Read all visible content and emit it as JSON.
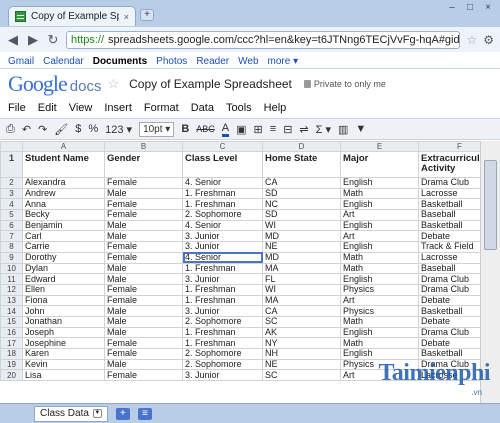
{
  "browser": {
    "tab_title": "Copy of Example Spreadsheet",
    "tab_close": "×",
    "new_tab": "+",
    "window_controls": [
      "–",
      "□",
      "×"
    ],
    "address_scheme": "https://",
    "address_rest": "spreadsheets.google.com/ccc?hl=en&key=t6JTNng6TECjVvFg-hqA#gid=0"
  },
  "google_bar": {
    "links": [
      "Gmail",
      "Calendar",
      "Documents",
      "Photos",
      "Reader",
      "Web",
      "more ▾"
    ],
    "active": "Documents"
  },
  "doc": {
    "logo_google": "Google",
    "logo_docs": "docs",
    "title": "Copy of Example Spreadsheet",
    "privacy": "Private to only me"
  },
  "menu": [
    "File",
    "Edit",
    "View",
    "Insert",
    "Format",
    "Data",
    "Tools",
    "Help"
  ],
  "toolbar": {
    "currency": "$",
    "percent": "%",
    "number_format": "123 ▾",
    "font_size": "10pt ▾",
    "bold": "B",
    "strike": "ABC",
    "sum": "Σ ▾"
  },
  "grid": {
    "column_letters": [
      "A",
      "B",
      "C",
      "D",
      "E",
      "F"
    ],
    "headers": [
      "Student Name",
      "Gender",
      "Class Level",
      "Home State",
      "Major",
      "Extracurricular Activity"
    ],
    "rows": [
      [
        "Alexandra",
        "Female",
        "4. Senior",
        "CA",
        "English",
        "Drama Club"
      ],
      [
        "Andrew",
        "Male",
        "1. Freshman",
        "SD",
        "Math",
        "Lacrosse"
      ],
      [
        "Anna",
        "Female",
        "1. Freshman",
        "NC",
        "English",
        "Basketball"
      ],
      [
        "Becky",
        "Female",
        "2. Sophomore",
        "SD",
        "Art",
        "Baseball"
      ],
      [
        "Benjamin",
        "Male",
        "4. Senior",
        "WI",
        "English",
        "Basketball"
      ],
      [
        "Carl",
        "Male",
        "3. Junior",
        "MD",
        "Art",
        "Debate"
      ],
      [
        "Carrie",
        "Female",
        "3. Junior",
        "NE",
        "English",
        "Track & Field"
      ],
      [
        "Dorothy",
        "Female",
        "4. Senior",
        "MD",
        "Math",
        "Lacrosse"
      ],
      [
        "Dylan",
        "Male",
        "1. Freshman",
        "MA",
        "Math",
        "Baseball"
      ],
      [
        "Edward",
        "Male",
        "3. Junior",
        "FL",
        "English",
        "Drama Club"
      ],
      [
        "Ellen",
        "Female",
        "1. Freshman",
        "WI",
        "Physics",
        "Drama Club"
      ],
      [
        "Fiona",
        "Female",
        "1. Freshman",
        "MA",
        "Art",
        "Debate"
      ],
      [
        "John",
        "Male",
        "3. Junior",
        "CA",
        "Physics",
        "Basketball"
      ],
      [
        "Jonathan",
        "Male",
        "2. Sophomore",
        "SC",
        "Math",
        "Debate"
      ],
      [
        "Joseph",
        "Male",
        "1. Freshman",
        "AK",
        "English",
        "Drama Club"
      ],
      [
        "Josephine",
        "Female",
        "1. Freshman",
        "NY",
        "Math",
        "Debate"
      ],
      [
        "Karen",
        "Female",
        "2. Sophomore",
        "NH",
        "English",
        "Basketball"
      ],
      [
        "Kevin",
        "Male",
        "2. Sophomore",
        "NE",
        "Physics",
        "Drama Club"
      ],
      [
        "Lisa",
        "Female",
        "3. Junior",
        "SC",
        "Art",
        "Lacrosse"
      ]
    ]
  },
  "sheet_tab": "Class Data",
  "watermark": "Taimienphi",
  "watermark_sub": ".vn"
}
